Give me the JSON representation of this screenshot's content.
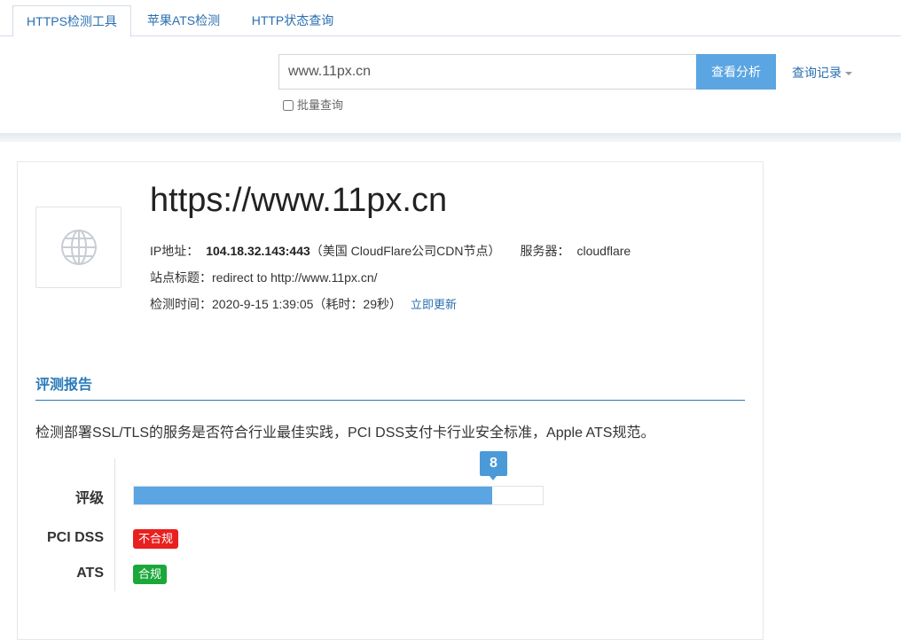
{
  "tabs": [
    {
      "label": "HTTPS检测工具",
      "active": true
    },
    {
      "label": "苹果ATS检测",
      "active": false
    },
    {
      "label": "HTTP状态查询",
      "active": false
    }
  ],
  "search": {
    "value": "www.11px.cn",
    "button_label": "查看分析",
    "history_label": "查询记录",
    "batch_label": "批量查询"
  },
  "site": {
    "url": "https://www.11px.cn",
    "ip_label": "IP地址：",
    "ip_value": "104.18.32.143:443",
    "ip_location": "（美国 CloudFlare公司CDN节点）",
    "server_label": "服务器：",
    "server_value": "cloudflare",
    "title_line": "站点标题：redirect to http://www.11px.cn/",
    "time_line": "检测时间：2020-9-15 1:39:05（耗时：29秒）",
    "refresh_label": "立即更新"
  },
  "report": {
    "title": "评测报告",
    "description": "检测部署SSL/TLS的服务是否符合行业最佳实践，PCI DSS支付卡行业安全标准，Apple ATS规范。",
    "grade_label": "评级",
    "grade_value": "8",
    "grade_fraction": 0.877,
    "pci_label": "PCI DSS",
    "pci_status": "不合规",
    "ats_label": "ATS",
    "ats_status": "合规"
  },
  "colors": {
    "accent": "#5aa5e2",
    "link": "#2a6fb0",
    "fail": "#e8201f",
    "pass": "#1ba83a"
  }
}
